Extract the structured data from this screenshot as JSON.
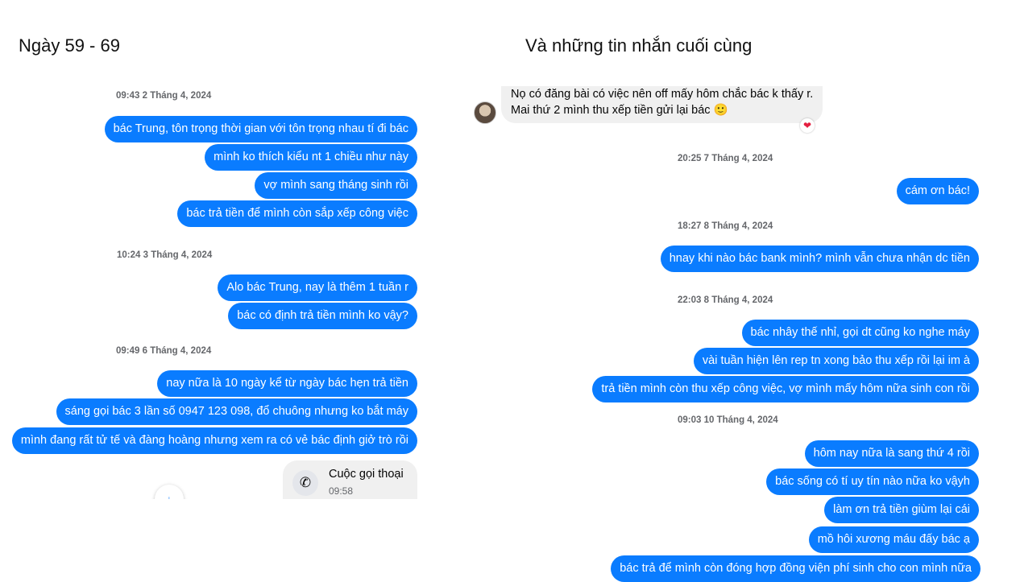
{
  "headings": {
    "left": "Ngày 59 - 69",
    "right": "Và những tin nhắn cuối cùng"
  },
  "left_panel": {
    "groups": [
      {
        "timestamp": "09:43 2 Tháng 4, 2024",
        "messages": [
          "bác Trung, tôn trọng thời gian với tôn trọng nhau tí đi bác",
          "mình ko thích kiểu nt 1 chiều như này",
          "vợ mình sang tháng sinh rồi",
          "bác trả tiền để mình còn sắp xếp công việc"
        ]
      },
      {
        "timestamp": "10:24 3 Tháng 4, 2024",
        "messages": [
          "Alo bác Trung, nay là thêm 1 tuần r",
          "bác có định trả tiền mình ko vậy?"
        ]
      },
      {
        "timestamp": "09:49 6 Tháng 4, 2024",
        "messages": [
          "nay nữa là 10 ngày kể từ ngày bác hẹn trả tiền",
          "sáng gọi bác 3 lần số 0947 123 098, đổ chuông nhưng ko bắt máy",
          "mình đang rất tử tế và đàng hoàng nhưng xem ra có vẻ bác định giở trò rồi"
        ]
      }
    ],
    "call": {
      "title": "Cuộc gọi thoại",
      "time": "09:58",
      "icon": "missed-call-icon"
    },
    "scroll_icon": "arrow-down-icon"
  },
  "right_panel": {
    "incoming": {
      "line1": "Nọ có đăng bài có việc nên off mấy hôm chắc bác k thấy r.",
      "line2": "Mai thứ 2 mình thu xếp tiền gửi lại bác 🙂",
      "reaction": "❤"
    },
    "groups": [
      {
        "timestamp": "20:25 7 Tháng 4, 2024",
        "messages": [
          "cám ơn bác!"
        ]
      },
      {
        "timestamp": "18:27 8 Tháng 4, 2024",
        "messages": [
          "hnay khi nào bác bank mình? mình vẫn chưa nhận dc tiền"
        ]
      },
      {
        "timestamp": "22:03 8 Tháng 4, 2024",
        "messages": [
          "bác nhây thế nhỉ, gọi dt cũng ko nghe máy",
          "vài tuần hiện lên rep tn xong bảo thu xếp rồi lại im à",
          "trả tiền mình còn thu xếp công việc, vợ mình mấy hôm nữa sinh con rồi"
        ]
      },
      {
        "timestamp": "09:03 10 Tháng 4, 2024",
        "messages": [
          "hôm nay nữa là sang thứ 4 rồi",
          "bác sống có tí uy tín nào nữa ko vậyh",
          "làm ơn trả tiền giùm lại cái",
          "mồ hôi xương máu đấy bác ạ",
          "bác trả để mình còn đóng hợp đồng viện phí sinh cho con mình nữa"
        ]
      }
    ]
  },
  "colors": {
    "outgoing_bubble": "#0a7cff",
    "incoming_bubble": "#f0f0f0",
    "timestamp": "#65676b"
  }
}
